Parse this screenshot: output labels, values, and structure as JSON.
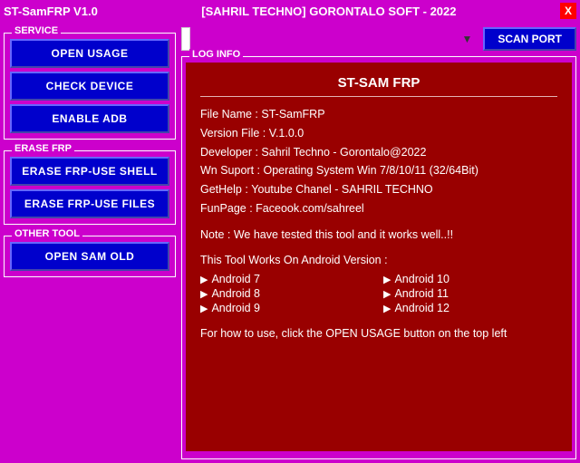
{
  "titleBar": {
    "left": "ST-SamFRP V1.0",
    "center": "[SAHRIL TECHNO]   GORONTALO SOFT - 2022",
    "closeLabel": "X"
  },
  "leftPanel": {
    "serviceGroup": {
      "label": "SERVICE",
      "buttons": [
        {
          "id": "open-usage-btn",
          "label": "OPEN USAGE"
        },
        {
          "id": "check-device-btn",
          "label": "CHECK DEVICE"
        },
        {
          "id": "enable-adb-btn",
          "label": "ENABLE ADB"
        }
      ]
    },
    "eraseFrpGroup": {
      "label": "ERASE FRP",
      "buttons": [
        {
          "id": "erase-frp-shell-btn",
          "label": "ERASE FRP-USE SHELL"
        },
        {
          "id": "erase-frp-files-btn",
          "label": "ERASE FRP-USE FILES"
        }
      ]
    },
    "otherToolGroup": {
      "label": "OTHER TOOL",
      "buttons": [
        {
          "id": "open-sam-old-btn",
          "label": "OPEN SAM OLD"
        }
      ]
    }
  },
  "rightPanel": {
    "scanPortLabel": "SCAN PORT",
    "portSelectPlaceholder": "",
    "logInfo": {
      "label": "LOG INFO",
      "title": "ST-SAM FRP",
      "lines": [
        {
          "key": "fileName",
          "label": "File Name :",
          "value": "ST-SamFRP"
        },
        {
          "key": "versionFile",
          "label": "Version File :",
          "value": "V.1.0.0"
        },
        {
          "key": "developer",
          "label": "Developer :",
          "value": "Sahril Techno - Gorontalo@2022"
        },
        {
          "key": "wnSuport",
          "label": "Wn Suport :",
          "value": "Operating System Win 7/8/10/11 (32/64Bit)"
        },
        {
          "key": "getHelp",
          "label": "GetHelp :",
          "value": "Youtube Chanel - SAHRIL TECHNO"
        },
        {
          "key": "funPage",
          "label": "FunPage :",
          "value": "Faceook.com/sahreel"
        }
      ],
      "note": "Note : We have tested this tool and it works well..!!",
      "androidSection": {
        "title": "This Tool Works On Android Version :",
        "items": [
          "Android 7",
          "Android 10",
          "Android 8",
          "Android 11",
          "Android 9",
          "Android 12"
        ]
      },
      "footer": "For how to use, click the OPEN USAGE button on the top left"
    }
  }
}
